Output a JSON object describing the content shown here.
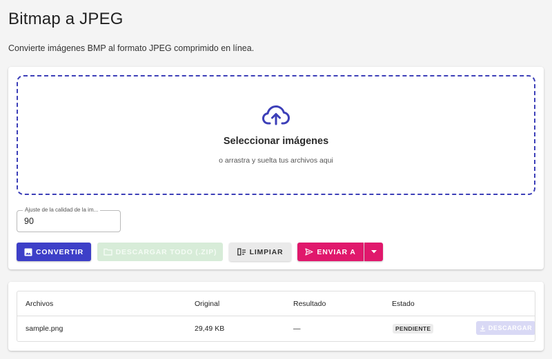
{
  "page": {
    "title": "Bitmap a JPEG",
    "subtitle": "Convierte imágenes BMP al formato JPEG comprimido en línea."
  },
  "dropzone": {
    "title": "Seleccionar imágenes",
    "subtitle": "o arrastra y suelta tus archivos aqui",
    "icon": "cloud-upload-icon",
    "accent_color": "#3c3fb8"
  },
  "quality": {
    "label": "Ajuste de la calidad de la im...",
    "value": "90"
  },
  "toolbar": {
    "convert_label": "Convertir",
    "download_all_label": "Descargar todo (.zip)",
    "clear_label": "Limpiar",
    "send_label": "Enviar a",
    "colors": {
      "convert": "#3d3fc8",
      "download_all_disabled": "#d7ecd8",
      "clear": "#eaeaea",
      "send": "#e0186c"
    }
  },
  "files": {
    "columns": [
      "Archivos",
      "Original",
      "Resultado",
      "Estado"
    ],
    "rows": [
      {
        "name": "sample.png",
        "original": "29,49 KB",
        "result": "—",
        "status": "PENDIENTE",
        "action": "DESCARGAR"
      }
    ]
  }
}
